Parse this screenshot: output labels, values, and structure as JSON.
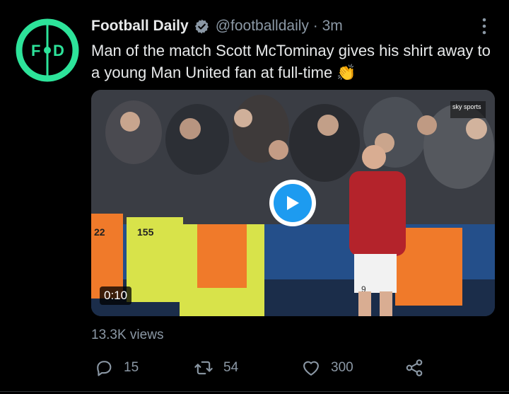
{
  "tweet": {
    "display_name": "Football Daily",
    "handle_time": "@footballdaily · 3m",
    "text": "Man of the match Scott McTominay gives his shirt away to a young Man United fan at full-time 👏",
    "avatar_text": "F D",
    "media": {
      "duration": "0:10",
      "overlay_logo": "sky sports",
      "steward_numbers": [
        "22",
        "155"
      ],
      "shirt_number": "9"
    },
    "views": "13.3K views",
    "counts": {
      "replies": "15",
      "retweets": "54",
      "likes": "300"
    }
  },
  "colors": {
    "background": "#000000",
    "accent_blue": "#1d9bf0",
    "avatar_green": "#2de39a",
    "muted": "#8b98a5",
    "text": "#e7e9ea"
  },
  "icons": {
    "verified": "verified-badge-icon",
    "more": "more-options-icon",
    "reply": "reply-icon",
    "retweet": "retweet-icon",
    "like": "heart-icon",
    "share": "share-icon",
    "play": "play-icon"
  }
}
